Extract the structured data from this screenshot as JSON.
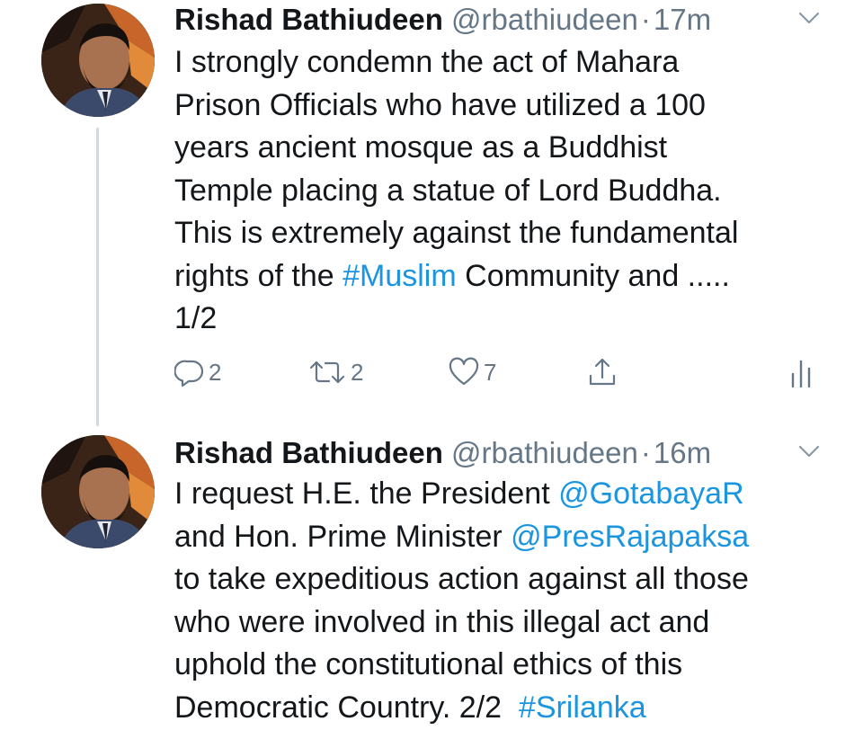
{
  "tweets": [
    {
      "name": "Rishad Bathiudeen",
      "handle": "@rbathiudeen",
      "separator": "·",
      "time": "17m",
      "lines": [
        [
          {
            "text": "I strongly condemn the act of Mahara",
            "link": false
          }
        ],
        [
          {
            "text": "Prison Officials who have utilized a 100",
            "link": false
          }
        ],
        [
          {
            "text": "years ancient mosque as a Buddhist",
            "link": false
          }
        ],
        [
          {
            "text": "Temple placing a statue of Lord Buddha.",
            "link": false
          }
        ],
        [
          {
            "text": "This is extremely against the fundamental",
            "link": false
          }
        ],
        [
          {
            "text": "rights of the ",
            "link": false
          },
          {
            "text": "#Muslim",
            "link": true
          },
          {
            "text": " Community and .....",
            "link": false
          }
        ],
        [
          {
            "text": "1/2",
            "link": false
          }
        ]
      ],
      "actions": {
        "reply_count": "2",
        "retweet_count": "2",
        "like_count": "7"
      }
    },
    {
      "name": "Rishad Bathiudeen",
      "handle": "@rbathiudeen",
      "separator": "·",
      "time": "16m",
      "lines": [
        [
          {
            "text": "I request H.E. the President ",
            "link": false
          },
          {
            "text": "@GotabayaR",
            "link": true
          }
        ],
        [
          {
            "text": "and Hon. Prime Minister ",
            "link": false
          },
          {
            "text": "@PresRajapaksa",
            "link": true
          }
        ],
        [
          {
            "text": "to take expeditious action against all those",
            "link": false
          }
        ],
        [
          {
            "text": "who were involved in this illegal act and",
            "link": false
          }
        ],
        [
          {
            "text": "uphold the constitutional ethics of this",
            "link": false
          }
        ],
        [
          {
            "text": "Democratic Country. 2/2  ",
            "link": false
          },
          {
            "text": "#Srilanka",
            "link": true
          }
        ]
      ]
    }
  ],
  "colors": {
    "text": "#14171a",
    "secondary": "#657786",
    "link": "#1b95e0",
    "thread_line": "#cfd9de"
  },
  "icons": [
    "chevron-down-icon",
    "reply-icon",
    "retweet-icon",
    "like-icon",
    "share-icon",
    "analytics-icon"
  ]
}
